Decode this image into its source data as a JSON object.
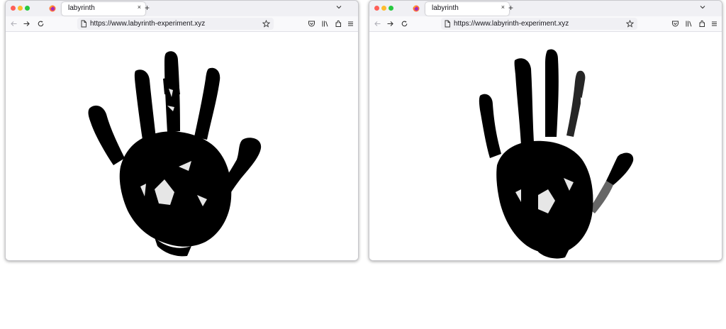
{
  "windows": [
    {
      "tab": {
        "title": "labyrinth"
      },
      "address_bar": {
        "url": "https://www.labyrinth-experiment.xyz"
      },
      "content": {
        "image": "black-handprint-left"
      }
    },
    {
      "tab": {
        "title": "labyrinth"
      },
      "address_bar": {
        "url": "https://www.labyrinth-experiment.xyz"
      },
      "content": {
        "image": "black-handprint-right"
      }
    }
  ],
  "colors": {
    "close": "#fe5f57",
    "minimize": "#febc2e",
    "maximize": "#28c840",
    "tabbar": "#f0f0f4",
    "toolbar": "#f9f9fb",
    "ink": "#000000"
  },
  "icons": {
    "new_tab": "+",
    "tab_close": "×",
    "back": "back-arrow-icon",
    "forward": "forward-arrow-icon",
    "reload": "reload-icon",
    "page": "page-icon",
    "bookmark": "star-icon",
    "pocket": "pocket-icon",
    "library": "library-icon",
    "extensions": "extensions-icon",
    "menu": "hamburger-menu-icon"
  }
}
